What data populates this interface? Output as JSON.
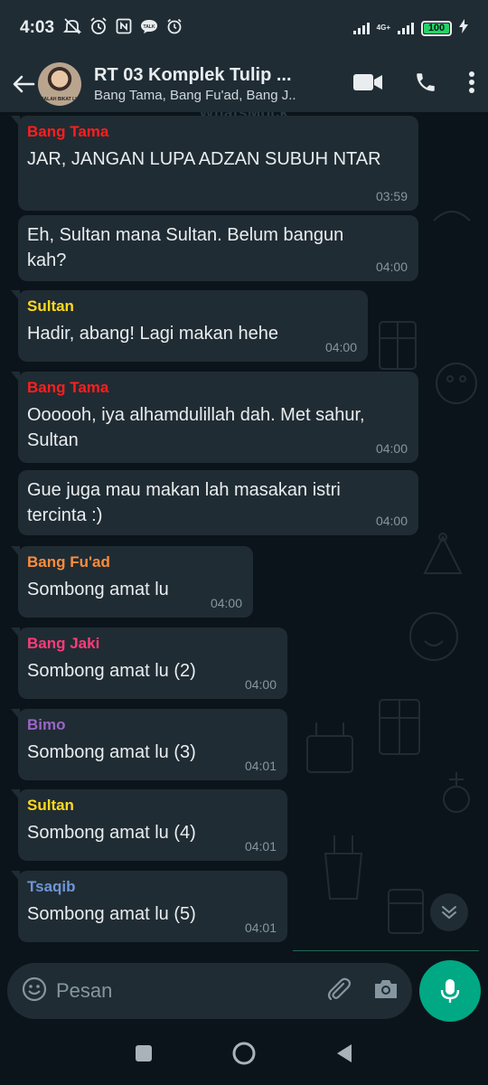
{
  "status_bar": {
    "time": "4:03",
    "network": "4G+",
    "battery": "100",
    "battery_level": 1.0,
    "icons": [
      "mute-icon",
      "alarm-icon",
      "nfc-icon",
      "talk-icon",
      "clock-icon",
      "signal-icon",
      "battery-icon",
      "charging-icon"
    ]
  },
  "header": {
    "title": "RT 03 Komplek Tulip ...",
    "subtitle": "Bang Tama, Bang Fu'ad, Bang J..",
    "avatar_caption": "SALAH BIKAT LK",
    "icons": [
      "back-arrow-icon",
      "video-call-icon",
      "phone-icon",
      "more-vert-icon"
    ]
  },
  "watermark": "WhatsMock",
  "messages": [
    {
      "sender": "Bang Tama",
      "sender_color": "#ff1f1f",
      "text": "JAR, JANGAN LUPA ADZAN SUBUH NTAR",
      "time": "03:59"
    },
    {
      "sender": "",
      "sender_color": "",
      "text": "Eh, Sultan mana Sultan. Belum bangun kah?",
      "time": "04:00"
    },
    {
      "sender": "Sultan",
      "sender_color": "#ffd91f",
      "text": "Hadir, abang! Lagi makan hehe",
      "time": "04:00"
    },
    {
      "sender": "Bang Tama",
      "sender_color": "#ff1f1f",
      "text": "Oooooh, iya alhamdulillah dah. Met sahur, Sultan",
      "time": "04:00"
    },
    {
      "sender": "",
      "sender_color": "",
      "text": "Gue juga mau makan lah masakan istri tercinta :)",
      "time": "04:00"
    },
    {
      "sender": "Bang Fu'ad",
      "sender_color": "#ff8c3b",
      "text": "Sombong amat lu",
      "time": "04:00"
    },
    {
      "sender": "Bang Jaki",
      "sender_color": "#ff3b7a",
      "text": "Sombong amat lu (2)",
      "time": "04:00"
    },
    {
      "sender": "Bimo",
      "sender_color": "#9a66c7",
      "text": "Sombong amat lu (3)",
      "time": "04:01"
    },
    {
      "sender": "Sultan",
      "sender_color": "#ffd91f",
      "text": "Sombong amat lu (4)",
      "time": "04:01"
    },
    {
      "sender": "Tsaqib",
      "sender_color": "#6f95d6",
      "text": "Sombong amat lu (5)",
      "time": "04:01"
    }
  ],
  "input": {
    "placeholder": "Pesan",
    "icons": [
      "emoji-icon",
      "attach-icon",
      "camera-icon",
      "mic-icon"
    ]
  },
  "colors": {
    "accent": "#00a884",
    "bubble": "#202c33",
    "header_bg": "#1f2c34",
    "chat_bg": "#0b141a"
  }
}
